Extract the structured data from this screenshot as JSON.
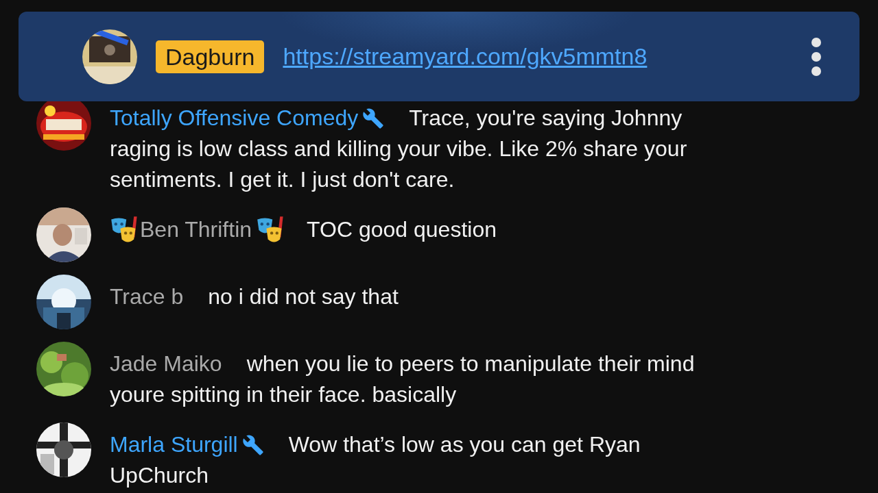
{
  "pinned": {
    "author_badge": "Dagburn",
    "link": "https://streamyard.com/gkv5mmtn8"
  },
  "messages": [
    {
      "author": "Totally Offensive Comedy",
      "moderator": true,
      "masks": false,
      "lines": [
        "Trace, you're saying Johnny",
        "raging is low class and killing your vibe. Like 2% share your",
        "sentiments. I get it. I just don't care."
      ]
    },
    {
      "author": "Ben Thriftin",
      "moderator": false,
      "masks": true,
      "lines": [
        "TOC good question"
      ]
    },
    {
      "author": "Trace b",
      "moderator": false,
      "masks": false,
      "lines": [
        "no i did not say that"
      ]
    },
    {
      "author": "Jade Maiko",
      "moderator": false,
      "masks": false,
      "lines": [
        "when you lie to peers to manipulate their mind",
        "youre spitting in their face. basically"
      ]
    },
    {
      "author": "Marla Sturgill",
      "moderator": true,
      "masks": false,
      "lines": [
        "Wow that’s low as you can get Ryan",
        "UpChurch"
      ]
    }
  ]
}
